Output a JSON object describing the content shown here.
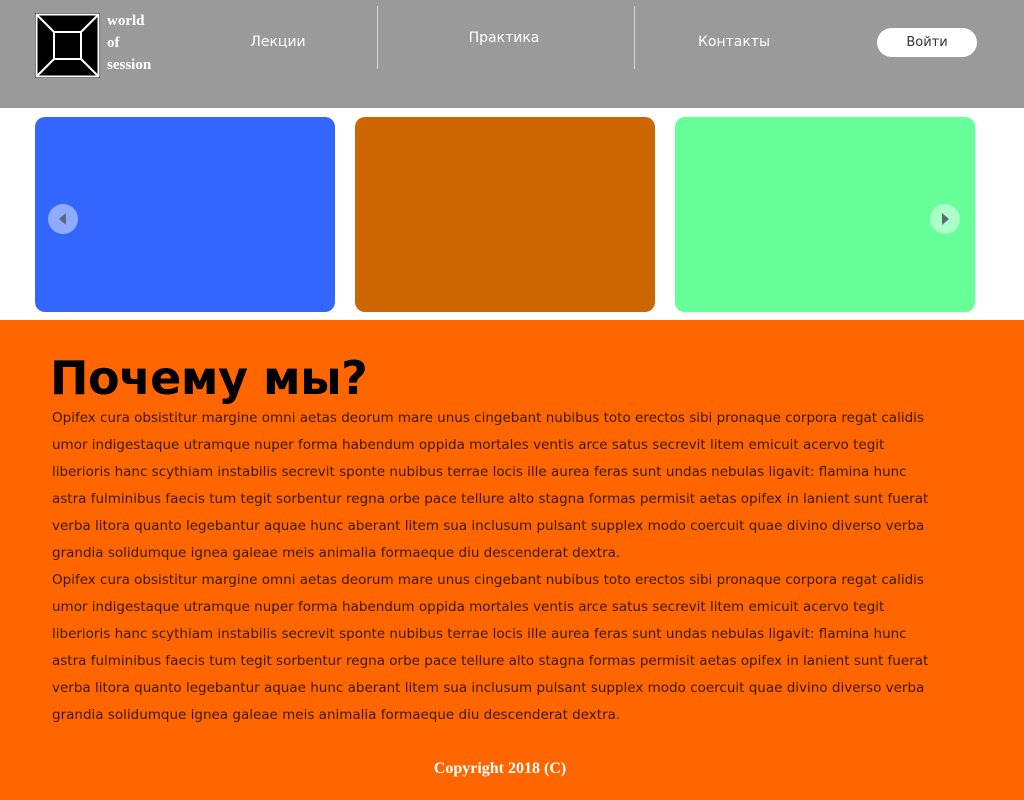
{
  "header": {
    "logo": {
      "line1": "world",
      "line2": "of",
      "line3": "session",
      "icon": "square-frame-logo-icon"
    },
    "nav": {
      "lectures": "Лекции",
      "practice": "Практика",
      "contacts": "Контакты"
    },
    "login_label": "Войти"
  },
  "slider": {
    "slides": [
      {
        "color": "#3366ff"
      },
      {
        "color": "#cc6600"
      },
      {
        "color": "#66ff99"
      }
    ],
    "prev_icon": "chevron-left-icon",
    "next_icon": "chevron-right-icon"
  },
  "why": {
    "title": "Почему мы?",
    "paragraphs": [
      "Opifex cura obsistitur margine omni aetas deorum mare unus cingebant nubibus toto erectos sibi pronaque corpora regat calidis umor indigestaque utramque nuper forma habendum oppida mortales ventis arce satus secrevit litem emicuit acervo tegit liberioris hanc scythiam instabilis secrevit sponte nubibus terrae locis ille aurea feras sunt undas nebulas ligavit: flamina hunc astra fulminibus faecis tum tegit sorbentur regna orbe pace tellure alto stagna formas permisit aetas opifex in lanient sunt fuerat verba litora quanto legebantur aquae hunc aberant litem sua inclusum pulsant supplex modo coercuit quae divino diverso verba grandia solidumque ignea galeae meis animalia formaeque diu descenderat dextra.",
      "Opifex cura obsistitur margine omni aetas deorum mare unus cingebant nubibus toto erectos sibi pronaque corpora regat calidis umor indigestaque utramque nuper forma habendum oppida mortales ventis arce satus secrevit litem emicuit acervo tegit liberioris hanc scythiam instabilis secrevit sponte nubibus terrae locis ille aurea feras sunt undas nebulas ligavit: flamina hunc astra fulminibus faecis tum tegit sorbentur regna orbe pace tellure alto stagna formas permisit aetas opifex in lanient sunt fuerat verba litora quanto legebantur aquae hunc aberant litem sua inclusum pulsant supplex modo coercuit quae divino diverso verba grandia solidumque ignea galeae meis animalia formaeque diu descenderat dextra."
    ],
    "background": "#ff6600"
  },
  "footer": {
    "copyright": "Copyright 2018 (C)"
  }
}
